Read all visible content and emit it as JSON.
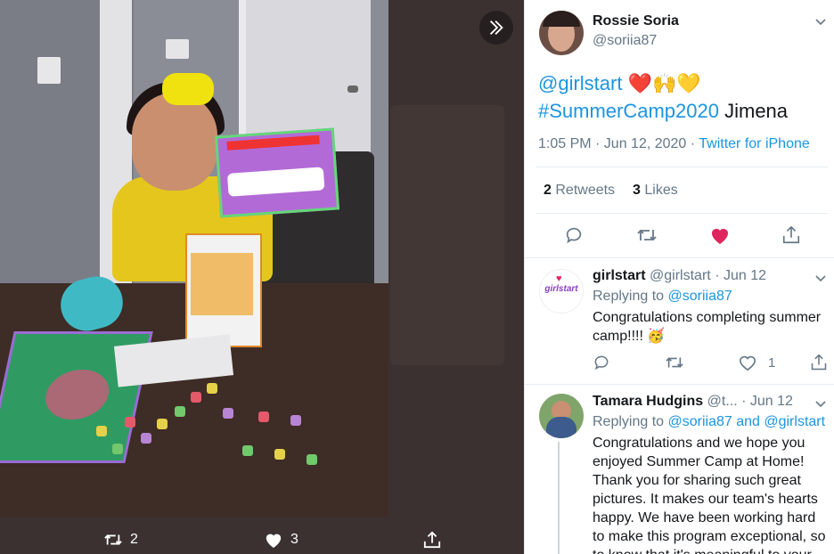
{
  "lightbox": {
    "actions": {
      "retweet_count": "2",
      "like_count": "3"
    }
  },
  "main_tweet": {
    "author_name": "Rossie Soria",
    "author_handle": "@soriia87",
    "text_mention": "@girlstart",
    "text_emojis": "❤️🙌💛",
    "text_hashtag": "#SummerCamp2020",
    "text_name": "Jimena",
    "time": "1:05 PM · Jun 12, 2020 ·",
    "source": "Twitter for iPhone",
    "retweets_count": "2",
    "retweets_label": "Retweets",
    "likes_count": "3",
    "likes_label": "Likes"
  },
  "replies": [
    {
      "author_name": "girlstart",
      "author_handle": "@girlstart",
      "date": "· Jun 12",
      "replying_prefix": "Replying to",
      "replying_to": "@soriia87",
      "text": "Congratulations completing summer camp!!!! 🥳",
      "like_count": "1",
      "avatar_text": "girlstart"
    },
    {
      "author_name": "Tamara Hudgins",
      "author_handle": "@t...",
      "date": "· Jun 12",
      "replying_prefix": "Replying to",
      "replying_to": "@soriia87 and @girlstart",
      "text": "Congratulations and we hope you enjoyed Summer Camp at Home! Thank you for sharing such great pictures. It makes our team's hearts happy. We have been working hard to make this program exceptional, so to know that it's meaningful to your"
    }
  ],
  "colors": {
    "link_blue": "#1b95e0",
    "like_red": "#e0245e",
    "text_primary": "#14171a",
    "text_secondary": "#657786"
  },
  "icons": [
    "double-chevron-right-icon",
    "retweet-icon",
    "heart-icon",
    "share-icon",
    "reply-icon",
    "chevron-down-icon"
  ]
}
